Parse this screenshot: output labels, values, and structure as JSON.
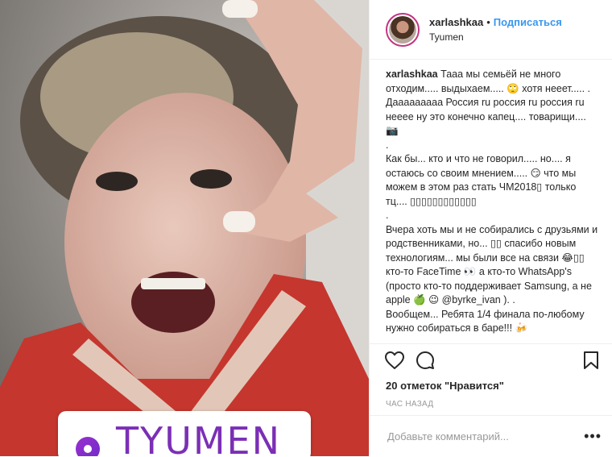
{
  "header": {
    "username": "xarlashkaa",
    "separator": "•",
    "follow_label": "Подписаться",
    "location": "Tyumen"
  },
  "caption": {
    "username": "xarlashkaa",
    "text": " Тааа мы семьёй не много отходим..... выдыхаем..... 🙄 хотя нееет..... . Дааааааааа Россия ru россия ru россия ru нееее ну это конечно капец.... товарищи.... 📷\n.\nКак бы... кто и что не говорил..... но.... я остаюсь со своим мнением..... 😏 что мы можем в этом раз стать ЧМ2018▯ только тц.... ▯▯▯▯▯▯▯▯▯▯▯▯\n.\nВчера хоть мы и не собирались с друзьями и родственниками, но... ▯▯ спасибо новым технологиям... мы были все на связи 😂▯▯ кто-то FaceTime 👀 а кто-то WhatsApp's (просто кто-то поддерживает Samsung, а не apple 🍏 😉 @byrke_ivan ). .\nВообщем... Ребята 1/4 финала по-любому нужно собираться в баре!!! 🍻"
  },
  "photo": {
    "geo_sticker_text": "TYUMEN"
  },
  "actions": {
    "likes": "20 отметок \"Нравится\"",
    "time": "час назад"
  },
  "comment_box": {
    "placeholder": "Добавьте комментарий...",
    "more": "•••"
  },
  "colors": {
    "accent": "#3897f0",
    "geo_purple": "#7b2fb5"
  }
}
